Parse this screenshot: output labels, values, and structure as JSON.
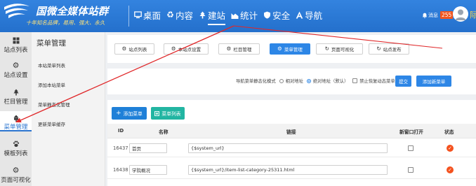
{
  "header": {
    "logo_title": "国微全媒体站群",
    "logo_subtitle": "十年知名品牌，易用、强大、永久",
    "nav": [
      {
        "label": "桌面",
        "icon": "monitor-icon",
        "active": false
      },
      {
        "label": "内容",
        "icon": "recycle-icon",
        "active": false
      },
      {
        "label": "建站",
        "icon": "tree-icon",
        "active": true
      },
      {
        "label": "统计",
        "icon": "area-chart-icon",
        "active": false
      },
      {
        "label": "安全",
        "icon": "shield-icon",
        "active": false
      },
      {
        "label": "导航",
        "icon": "navigation-icon",
        "active": false
      }
    ],
    "messages_label": "消息",
    "messages_count": "255",
    "user_name": "际"
  },
  "sidebar": {
    "items": [
      {
        "label": "站点列表",
        "icon": "grid-icon",
        "active": false
      },
      {
        "label": "站点设置",
        "icon": "gear-icon",
        "active": false
      },
      {
        "label": "栏目管理",
        "icon": "tree-icon",
        "active": false
      },
      {
        "label": "菜单管理",
        "icon": "sitemap-icon",
        "active": true
      },
      {
        "label": "模板列表",
        "icon": "paw-icon",
        "active": false
      },
      {
        "label": "页面可视化",
        "icon": "settings-icon",
        "active": false
      }
    ]
  },
  "subnav": {
    "title": "菜单管理",
    "items": [
      {
        "label": "本站菜单列表"
      },
      {
        "label": "添加本站菜单"
      },
      {
        "label": "菜单静态化管理"
      },
      {
        "label": "更新菜单缓存"
      }
    ]
  },
  "toolbar": {
    "buttons": [
      {
        "label": "站点列表",
        "icon": "gear-icon",
        "active": false
      },
      {
        "label": "本站点设置",
        "icon": "gear-icon",
        "active": false
      },
      {
        "label": "栏目管理",
        "icon": "gear-icon",
        "active": false
      },
      {
        "label": "菜单管理",
        "icon": "gear-icon",
        "active": true
      },
      {
        "label": "页面可视化",
        "icon": "refresh-icon",
        "active": false
      },
      {
        "label": "站点发布",
        "icon": "refresh-icon",
        "active": false
      }
    ]
  },
  "static_mode": {
    "label": "导航菜单静态化模式",
    "option_relative": "相对地址",
    "option_relative_checked": false,
    "option_absolute": "绝对地址（默认）",
    "option_absolute_checked": true,
    "disable_restore_label": "禁止恢复动态菜单",
    "disable_restore_checked": false,
    "submit_label": "提交",
    "add_new_label": "添加新菜单"
  },
  "menu_panel": {
    "add_label": "添加菜单",
    "list_label": "菜单列表"
  },
  "table": {
    "columns": [
      "ID",
      "名称",
      "链接",
      "新窗口打开",
      "状态"
    ],
    "rows": [
      {
        "id": "16437",
        "name": "首页",
        "link": "{$system_url}",
        "new_window": false,
        "enabled": true
      },
      {
        "id": "16438",
        "name": "学院概况",
        "link": "{$system_url}/item-list-category-25311.html",
        "new_window": false,
        "enabled": true
      }
    ]
  },
  "colors": {
    "header_blue": "#2a76d2",
    "primary_blue": "#2d86e6",
    "add_button_blue": "#1f80d8",
    "teal": "#22b5a2",
    "status_orange": "#f4511e",
    "badge_orange": "#f0561f",
    "subtitle_yellow": "#ffe37a",
    "annotation_red": "#e0282a"
  }
}
